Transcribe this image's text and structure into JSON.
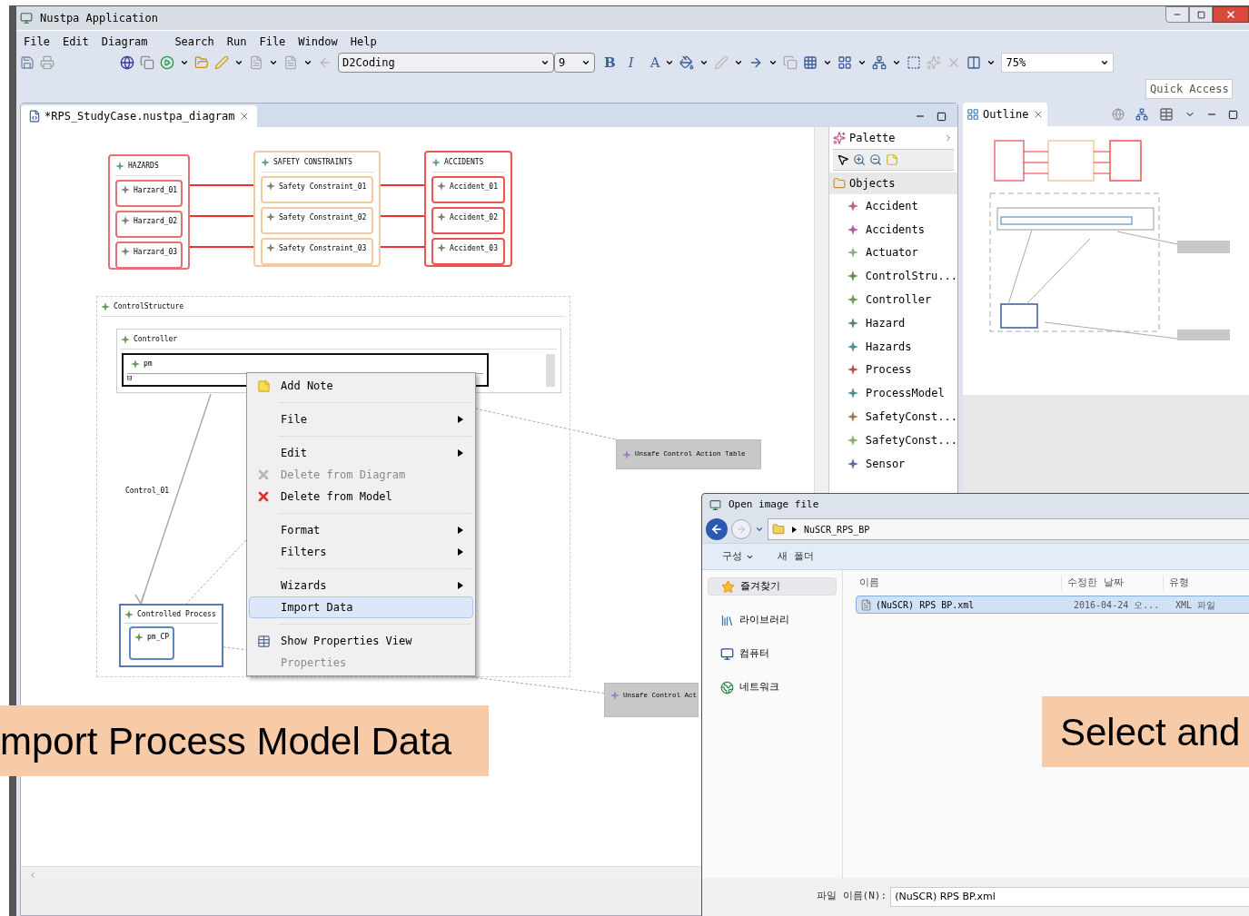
{
  "window": {
    "title": "Nustpa Application"
  },
  "menu": [
    "File",
    "Edit",
    "Diagram",
    "Search",
    "Run",
    "File",
    "Window",
    "Help"
  ],
  "toolbar": {
    "font": "D2Coding",
    "size": "9",
    "bold": "B",
    "italic": "I",
    "font_color": "A",
    "zoom": "75%"
  },
  "quick_access": {
    "placeholder": "Quick Access"
  },
  "editor_tab": {
    "title": "*RPS_StudyCase.nustpa_diagram"
  },
  "diagram": {
    "groups": [
      {
        "title": "HAZARDS",
        "color": "#e57373",
        "items": [
          "Harzard_01",
          "Harzard_02",
          "Harzard_03"
        ]
      },
      {
        "title": "SAFETY CONSTRAINTS",
        "color": "#f5c9a0",
        "items": [
          "Safety Constraint_01",
          "Safety Constraint_02",
          "Safety Constraint_03"
        ]
      },
      {
        "title": "ACCIDENTS",
        "color": "#ef5350",
        "items": [
          "Accident_01",
          "Accident_02",
          "Accident_03"
        ]
      }
    ],
    "control_structure": {
      "title": "ControlStructure",
      "controller": "Controller",
      "pm": "pm",
      "pm_toggle": "⊟",
      "control_label": "Control_01",
      "process": "Controlled Process",
      "pm_cp": "pm_CP"
    },
    "uca_tables": [
      "Unsafe Control Action Table",
      "Unsafe Control Act"
    ]
  },
  "context_menu": [
    {
      "kind": "note",
      "label": "Add Note",
      "disabled": false,
      "submenu": false,
      "selected": false
    },
    {
      "kind": "separator"
    },
    {
      "kind": "plain",
      "label": "File",
      "disabled": false,
      "submenu": true,
      "selected": false
    },
    {
      "kind": "separator"
    },
    {
      "kind": "plain",
      "label": "Edit",
      "disabled": false,
      "submenu": true,
      "selected": false
    },
    {
      "kind": "delete",
      "label": "Delete from Diagram",
      "disabled": true,
      "submenu": false,
      "selected": false
    },
    {
      "kind": "delete",
      "label": "Delete from Model",
      "disabled": false,
      "submenu": false,
      "selected": false
    },
    {
      "kind": "separator"
    },
    {
      "kind": "plain",
      "label": "Format",
      "disabled": false,
      "submenu": true,
      "selected": false
    },
    {
      "kind": "plain",
      "label": "Filters",
      "disabled": false,
      "submenu": true,
      "selected": false
    },
    {
      "kind": "separator"
    },
    {
      "kind": "plain",
      "label": "Wizards",
      "disabled": false,
      "submenu": true,
      "selected": false
    },
    {
      "kind": "plain",
      "label": "Import Data",
      "disabled": false,
      "submenu": false,
      "selected": true
    },
    {
      "kind": "separator"
    },
    {
      "kind": "properties",
      "label": "Show Properties View",
      "disabled": false,
      "submenu": false,
      "selected": false
    },
    {
      "kind": "plain",
      "label": "Properties",
      "disabled": true,
      "submenu": false,
      "selected": false
    }
  ],
  "palette": {
    "title": "Palette",
    "drawer": "Objects",
    "items": [
      {
        "label": "Accident",
        "color": "#c2607a"
      },
      {
        "label": "Accidents",
        "color": "#b05a9a"
      },
      {
        "label": "Actuator",
        "color": "#8fb08a"
      },
      {
        "label": "ControlStru...",
        "color": "#5f8f4f"
      },
      {
        "label": "Controller",
        "color": "#6a9a55"
      },
      {
        "label": "Hazard",
        "color": "#5f8080"
      },
      {
        "label": "Hazards",
        "color": "#4a9090"
      },
      {
        "label": "Process",
        "color": "#c05050"
      },
      {
        "label": "ProcessModel",
        "color": "#4f8f8f"
      },
      {
        "label": "SafetyConst...",
        "color": "#9a7a50"
      },
      {
        "label": "SafetyConst...",
        "color": "#8aaa6a"
      },
      {
        "label": "Sensor",
        "color": "#5a6aaa"
      }
    ]
  },
  "outline": {
    "title": "Outline"
  },
  "dialog": {
    "title": "Open image file",
    "path": "NuSCR_RPS_BP",
    "toolbar": [
      "구성",
      "새 폴더"
    ],
    "nav": [
      {
        "label": "즐겨찾기",
        "selected": true
      },
      {
        "label": "라이브러리",
        "selected": false
      },
      {
        "label": "컴퓨터",
        "selected": false
      },
      {
        "label": "네트워크",
        "selected": false
      }
    ],
    "columns": [
      "이름",
      "수정한 날짜",
      "유형"
    ],
    "rows": [
      {
        "name": "(NuSCR) RPS BP.xml",
        "date": "2016-04-24 오...",
        "type": "XML 파일",
        "selected": true
      }
    ],
    "filename_label": "파일 이름(N):",
    "filename": "(NuSCR) RPS BP.xml"
  },
  "captions": [
    "mport Process Model Data",
    "Select and"
  ]
}
